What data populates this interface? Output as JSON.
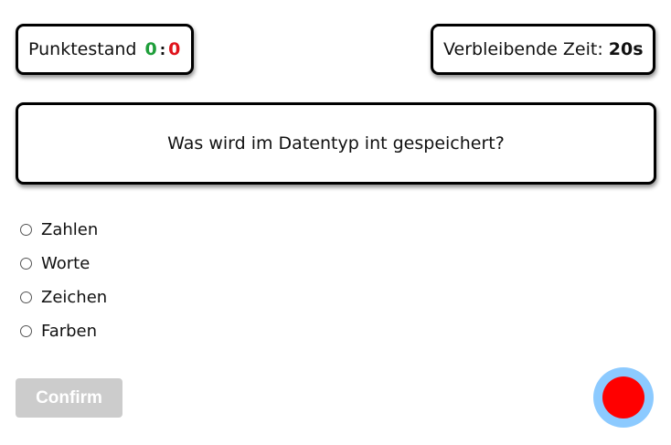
{
  "score": {
    "label": "Punktestand",
    "correct": "0",
    "separator": ":",
    "wrong": "0"
  },
  "timer": {
    "label": "Verbleibende Zeit:",
    "value": "20s"
  },
  "question": {
    "text": "Was wird im Datentyp int gespeichert?"
  },
  "options": [
    {
      "label": "Zahlen",
      "selected": false
    },
    {
      "label": "Worte",
      "selected": false
    },
    {
      "label": "Zeichen",
      "selected": false
    },
    {
      "label": "Farben",
      "selected": false
    }
  ],
  "confirm": {
    "label": "Confirm",
    "disabled": true
  },
  "record_button": {
    "icon": "record-icon",
    "ring_color": "#8ccaff",
    "dot_color": "#ff0000"
  },
  "colors": {
    "correct": "#1e9e3a",
    "wrong": "#e0141c",
    "disabled_button": "#cccccc"
  }
}
